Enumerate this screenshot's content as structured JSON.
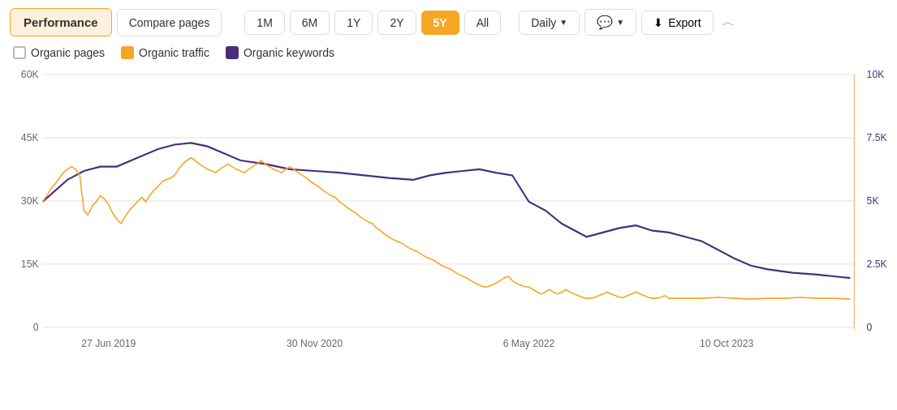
{
  "toolbar": {
    "performance_label": "Performance",
    "compare_label": "Compare pages",
    "period_1m": "1M",
    "period_6m": "6M",
    "period_1y": "1Y",
    "period_2y": "2Y",
    "period_5y": "5Y",
    "period_all": "All",
    "active_period": "5Y",
    "granularity": "Daily",
    "export_label": "Export"
  },
  "legend": {
    "organic_pages": "Organic pages",
    "organic_traffic": "Organic traffic",
    "organic_keywords": "Organic keywords"
  },
  "chart": {
    "y_left": [
      "60K",
      "45K",
      "30K",
      "15K",
      "0"
    ],
    "y_right": [
      "10K",
      "7.5K",
      "5K",
      "2.5K",
      "0"
    ],
    "x_labels": [
      "27 Jun 2019",
      "30 Nov 2020",
      "6 May 2022",
      "10 Oct 2023"
    ],
    "colors": {
      "orange": "#f5a623",
      "purple": "#4a2d7a",
      "grid": "#e8e8e8"
    }
  }
}
